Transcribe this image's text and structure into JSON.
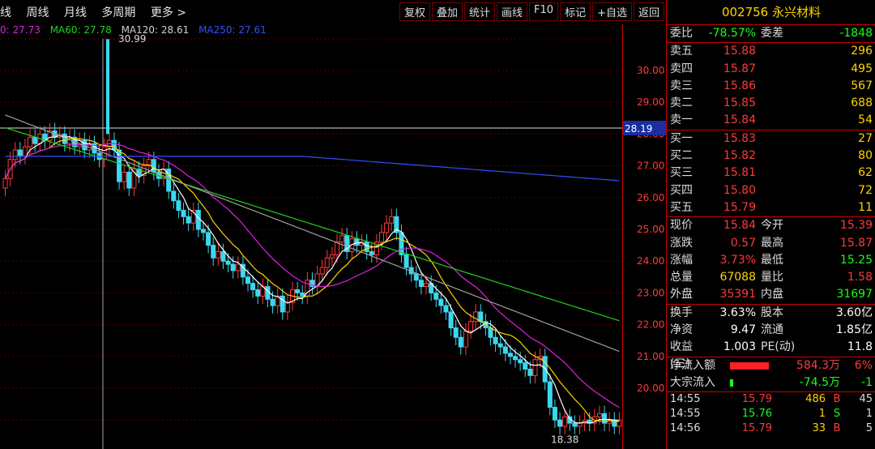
{
  "toolbar": {
    "tabs": [
      "线",
      "周线",
      "月线",
      "多周期",
      "更多 >"
    ],
    "buttons": [
      "复权",
      "叠加",
      "统计",
      "画线",
      "F10",
      "标记",
      "+自选",
      "返回"
    ]
  },
  "legend": {
    "ma_partial": "0: 27.73",
    "ma60": "MA60: 27.78",
    "ma120": "MA120: 28.61",
    "ma250": "MA250: 27.61"
  },
  "chart": {
    "y_ticks": [
      "30.00",
      "29.00",
      "28.00",
      "27.00",
      "26.00",
      "25.00",
      "24.00",
      "23.00",
      "22.00",
      "21.00",
      "20.00"
    ],
    "crosshair_price": "28.19",
    "high_label": "30.99",
    "low_label": "18.38",
    "colors": {
      "up": "#ff3a3a",
      "down": "#3ad8f0",
      "ma5": "#ffffff",
      "ma10": "#ffd400",
      "ma20": "#e020e0",
      "ma60": "#20d020",
      "ma120": "#a0a0a0",
      "ma250": "#3050ff"
    }
  },
  "stock": {
    "code": "002756",
    "name": "永兴材料"
  },
  "ratio": {
    "wb_label": "委比",
    "wb": "-78.57%",
    "wc_label": "委差",
    "wc": "-1848"
  },
  "asks": [
    {
      "label": "卖五",
      "price": "15.88",
      "vol": "296"
    },
    {
      "label": "卖四",
      "price": "15.87",
      "vol": "495"
    },
    {
      "label": "卖三",
      "price": "15.86",
      "vol": "567"
    },
    {
      "label": "卖二",
      "price": "15.85",
      "vol": "688"
    },
    {
      "label": "卖一",
      "price": "15.84",
      "vol": "54"
    }
  ],
  "bids": [
    {
      "label": "买一",
      "price": "15.83",
      "vol": "27"
    },
    {
      "label": "买二",
      "price": "15.82",
      "vol": "80"
    },
    {
      "label": "买三",
      "price": "15.81",
      "vol": "62"
    },
    {
      "label": "买四",
      "price": "15.80",
      "vol": "72"
    },
    {
      "label": "买五",
      "price": "15.79",
      "vol": "11"
    }
  ],
  "quote": [
    {
      "k": "现价",
      "v": "15.84",
      "vc": "red",
      "k2": "今开",
      "v2": "15.39",
      "v2c": "red"
    },
    {
      "k": "涨跌",
      "v": "0.57",
      "vc": "red",
      "k2": "最高",
      "v2": "15.87",
      "v2c": "red"
    },
    {
      "k": "涨幅",
      "v": "3.73%",
      "vc": "red",
      "k2": "最低",
      "v2": "15.25",
      "v2c": "green"
    },
    {
      "k": "总量",
      "v": "67088",
      "vc": "yellow",
      "k2": "量比",
      "v2": "1.58",
      "v2c": "red"
    },
    {
      "k": "外盘",
      "v": "35391",
      "vc": "red",
      "k2": "内盘",
      "v2": "31697",
      "v2c": "green"
    }
  ],
  "fin": [
    {
      "k": "换手",
      "v": "3.63%",
      "k2": "股本",
      "v2": "3.60亿"
    },
    {
      "k": "净资",
      "v": "9.47",
      "k2": "流通",
      "v2": "1.85亿"
    },
    {
      "k": "收益(三)",
      "v": "1.003",
      "k2": "PE(动)",
      "v2": "11.8"
    }
  ],
  "flows": [
    {
      "k": "净流入额",
      "v": "584.3万",
      "pct": "6%"
    },
    {
      "k": "大宗流入",
      "v": "-74.5万",
      "pct": "-1"
    }
  ],
  "trades": [
    {
      "t": "14:55",
      "p": "15.79",
      "vol": "486",
      "side": "B",
      "n": "45"
    },
    {
      "t": "14:55",
      "p": "15.76",
      "vol": "1",
      "side": "S",
      "n": "1"
    },
    {
      "t": "14:56",
      "p": "15.79",
      "vol": "33",
      "side": "B",
      "n": "5"
    }
  ]
}
